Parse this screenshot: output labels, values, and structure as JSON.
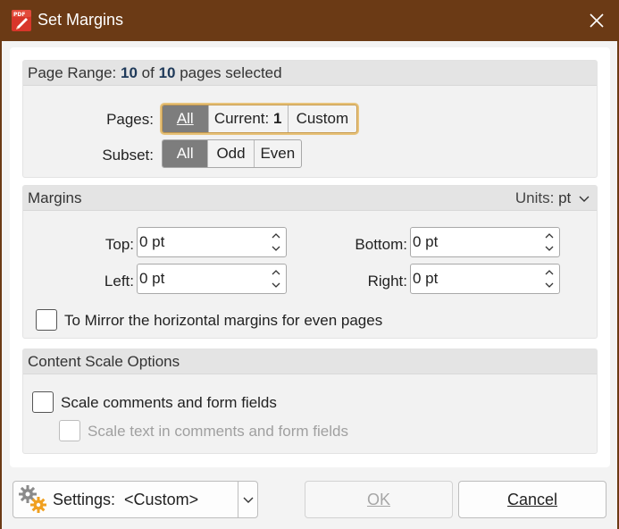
{
  "window": {
    "title": "Set Margins",
    "app_icon_text": "PDF"
  },
  "page_range": {
    "header_prefix": "Page Range:",
    "selected_count": "10",
    "of_word": "of",
    "total_count": "10",
    "header_suffix": "pages selected",
    "pages_label": "Pages:",
    "pages_options": {
      "all": "All",
      "current_prefix": "Current:",
      "current_value": "1",
      "custom": "Custom"
    },
    "pages_selected": "All",
    "subset_label": "Subset:",
    "subset_options": [
      "All",
      "Odd",
      "Even"
    ],
    "subset_selected": "All"
  },
  "margins": {
    "header": "Margins",
    "units_label": "Units:",
    "units_value": "pt",
    "top_label": "Top:",
    "top_value": "0 pt",
    "bottom_label": "Bottom:",
    "bottom_value": "0 pt",
    "left_label": "Left:",
    "left_value": "0 pt",
    "right_label": "Right:",
    "right_value": "0 pt",
    "mirror_label": "To Mirror the horizontal margins for even pages",
    "mirror_checked": false
  },
  "content_scale": {
    "header": "Content Scale Options",
    "scale_comments_label": "Scale comments and form fields",
    "scale_comments_checked": false,
    "scale_text_label": "Scale text in comments and form fields",
    "scale_text_checked": false,
    "scale_text_enabled": false
  },
  "footer": {
    "settings_label": "Settings:",
    "settings_value": "<Custom>",
    "ok_label": "OK",
    "cancel_label": "Cancel"
  },
  "colors": {
    "titlebar": "#6b3a15",
    "active_segment": "#7d7d7d",
    "focus_ring": "#e7c27a"
  }
}
